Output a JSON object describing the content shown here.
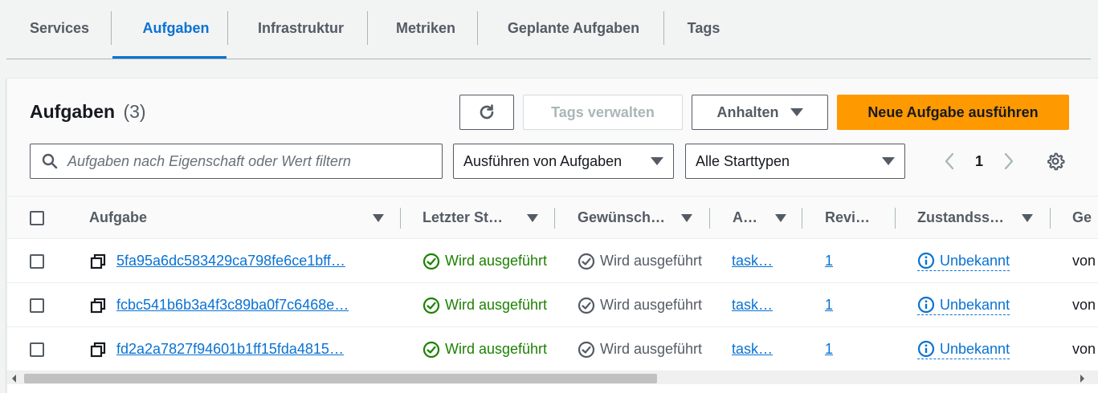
{
  "tabs": [
    {
      "label": "Services"
    },
    {
      "label": "Aufgaben"
    },
    {
      "label": "Infrastruktur"
    },
    {
      "label": "Metriken"
    },
    {
      "label": "Geplante Aufgaben"
    },
    {
      "label": "Tags"
    }
  ],
  "active_tab": "Aufgaben",
  "panel": {
    "title": "Aufgaben",
    "count": "(3)",
    "refresh_icon": "refresh-icon",
    "tags_button": "Tags verwalten",
    "stop_button": "Anhalten",
    "run_button": "Neue Aufgabe ausführen",
    "search_placeholder": "Aufgaben nach Eigenschaft oder Wert filtern",
    "filter_status": "Ausführen von Aufgaben",
    "filter_launch": "Alle Starttypen",
    "page": "1"
  },
  "columns": [
    "Aufgabe",
    "Letzter St…",
    "Gewünsch…",
    "A…",
    "Revi…",
    "Zustandss…",
    "Ge"
  ],
  "rows": [
    {
      "task": "5fa95a6dc583429ca798fe6ce1bff…",
      "last_status": "Wird ausgeführt",
      "desired": "Wird ausgeführt",
      "def": "task…",
      "revision": "1",
      "health": "Unbekannt",
      "group": "von"
    },
    {
      "task": "fcbc541b6b3a4f3c89ba0f7c6468e…",
      "last_status": "Wird ausgeführt",
      "desired": "Wird ausgeführt",
      "def": "task…",
      "revision": "1",
      "health": "Unbekannt",
      "group": "von"
    },
    {
      "task": "fd2a2a7827f94601b1ff15fda4815…",
      "last_status": "Wird ausgeführt",
      "desired": "Wird ausgeführt",
      "def": "task…",
      "revision": "1",
      "health": "Unbekannt",
      "group": "von"
    }
  ],
  "colors": {
    "accent": "#0972d3",
    "primary_button": "#ff9900",
    "success": "#1d8102"
  }
}
